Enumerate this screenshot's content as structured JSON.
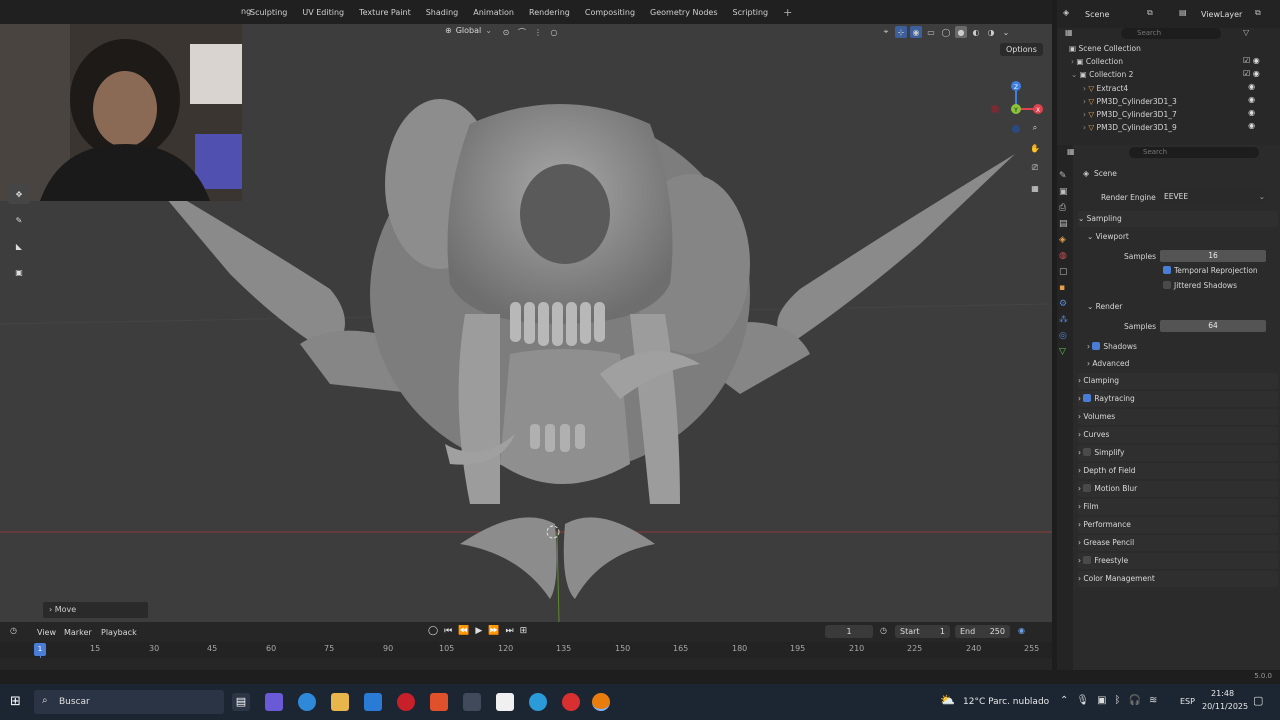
{
  "topmenu": {
    "partial_tab": "ng",
    "items": [
      "Sculpting",
      "UV Editing",
      "Texture Paint",
      "Shading",
      "Animation",
      "Rendering",
      "Compositing",
      "Geometry Nodes",
      "Scripting"
    ],
    "add_tab": "+"
  },
  "viewport": {
    "transform_orientation": "Global",
    "options_label": "Options",
    "move_panel_label": "Move",
    "gizmo": {
      "z": "Z",
      "y": "Y",
      "x": "X"
    }
  },
  "timeline": {
    "view": "View",
    "marker": "Marker",
    "playback": "Playback",
    "current_frame": "1",
    "start_label": "Start",
    "start_value": "1",
    "end_label": "End",
    "end_value": "250",
    "ruler_ticks": [
      "15",
      "30",
      "45",
      "60",
      "75",
      "90",
      "105",
      "120",
      "135",
      "150",
      "165",
      "180",
      "195",
      "210",
      "225",
      "240",
      "255"
    ],
    "playhead_label": "1"
  },
  "outliner": {
    "scene_label": "Scene",
    "view_layer_label": "ViewLayer",
    "search_placeholder": "Search",
    "rows": [
      {
        "label": "Scene Collection",
        "indent": 0
      },
      {
        "label": "Collection",
        "indent": 1
      },
      {
        "label": "Collection 2",
        "indent": 1
      },
      {
        "label": "Extract4",
        "indent": 2
      },
      {
        "label": "PM3D_Cylinder3D1_3",
        "indent": 2
      },
      {
        "label": "PM3D_Cylinder3D1_7",
        "indent": 2
      },
      {
        "label": "PM3D_Cylinder3D1_9",
        "indent": 2
      }
    ]
  },
  "properties": {
    "search_placeholder": "Search",
    "context": "Scene",
    "render_engine_label": "Render Engine",
    "render_engine_value": "EEVEE",
    "sampling": "Sampling",
    "viewport": "Viewport",
    "viewport_samples_label": "Samples",
    "viewport_samples": "16",
    "temporal_reprojection": "Temporal Reprojection",
    "jittered_shadows": "Jittered Shadows",
    "render": "Render",
    "render_samples_label": "Samples",
    "render_samples": "64",
    "shadows": "Shadows",
    "advanced": "Advanced",
    "sections": [
      "Clamping",
      "Raytracing",
      "Volumes",
      "Curves",
      "Simplify",
      "Depth of Field",
      "Motion Blur",
      "Film",
      "Performance",
      "Grease Pencil",
      "Freestyle",
      "Color Management"
    ]
  },
  "statusbar": {
    "version": "5.0.0"
  },
  "taskbar": {
    "search_label": "Buscar",
    "weather": "12°C  Parc. nublado",
    "lang": "ESP",
    "time": "21:48",
    "date": "20/11/2025"
  },
  "colors": {
    "accent_blue": "#4a7dd6",
    "x_axis": "#e0434f",
    "y_axis": "#8ac43a",
    "z_axis": "#3d7ee0"
  }
}
